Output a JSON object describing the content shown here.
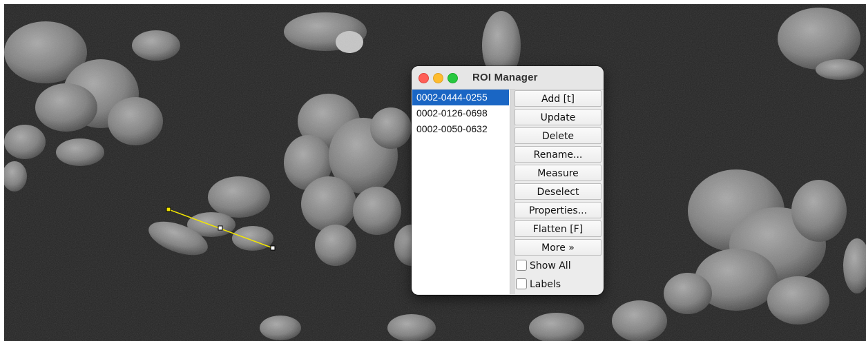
{
  "window": {
    "title": "ROI Manager"
  },
  "roi_list": [
    {
      "name": "0002-0444-0255",
      "selected": true
    },
    {
      "name": "0002-0126-0698",
      "selected": false
    },
    {
      "name": "0002-0050-0632",
      "selected": false
    }
  ],
  "buttons": {
    "add": "Add [t]",
    "update": "Update",
    "delete": "Delete",
    "rename": "Rename...",
    "measure": "Measure",
    "deselect": "Deselect",
    "properties": "Properties...",
    "flatten": "Flatten [F]",
    "more": "More »"
  },
  "checkboxes": {
    "show_all": {
      "label": "Show All",
      "checked": false
    },
    "labels": {
      "label": "Labels",
      "checked": false
    }
  },
  "colors": {
    "selection": "#1a66c4",
    "roi_line": "#f2e600",
    "close": "#ff5f57",
    "minimize": "#febc2e",
    "zoom": "#28c840"
  }
}
